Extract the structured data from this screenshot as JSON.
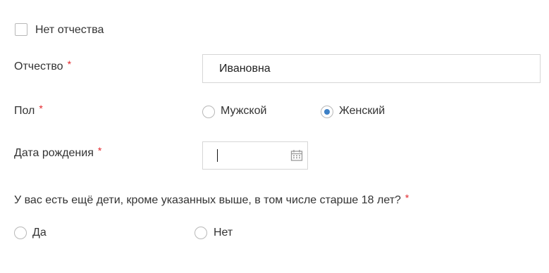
{
  "no_patronymic": {
    "label": "Нет отчества",
    "checked": false
  },
  "patronymic": {
    "label": "Отчество",
    "required_mark": "*",
    "value": "Ивановна"
  },
  "sex": {
    "label": "Пол",
    "required_mark": "*",
    "options": [
      {
        "label": "Мужской",
        "selected": false
      },
      {
        "label": "Женский",
        "selected": true
      }
    ]
  },
  "birth_date": {
    "label": "Дата рождения",
    "required_mark": "*",
    "value": ""
  },
  "other_children": {
    "question": "У вас есть ещё дети, кроме указанных выше, в том числе старше 18 лет?",
    "required_mark": "*",
    "options": [
      {
        "label": "Да",
        "selected": false
      },
      {
        "label": "Нет",
        "selected": false
      }
    ]
  },
  "colors": {
    "accent": "#3d80c6",
    "required": "#e3262b",
    "border": "#d6d6d6"
  }
}
